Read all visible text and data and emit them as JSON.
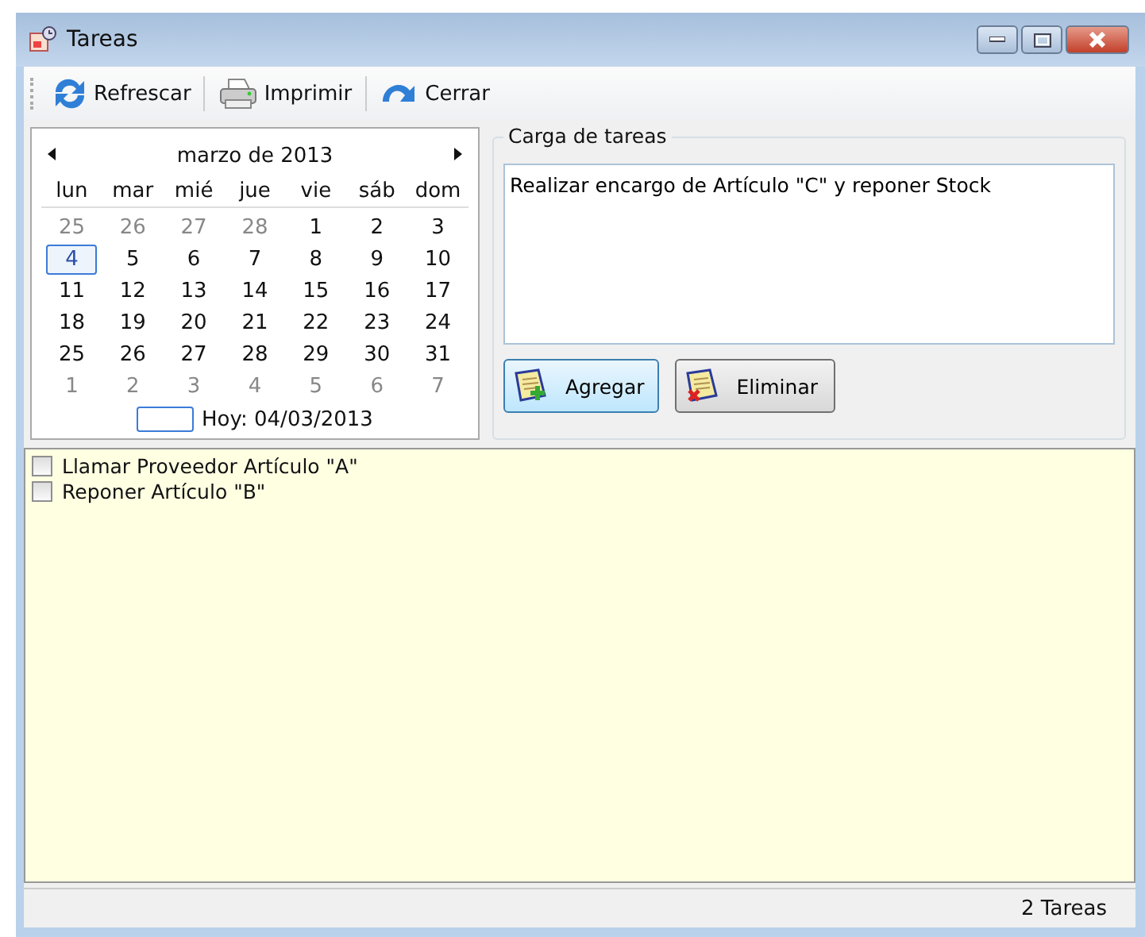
{
  "window": {
    "title": "Tareas"
  },
  "toolbar": [
    {
      "kind": "refresh",
      "label": "Refrescar"
    },
    {
      "kind": "print",
      "label": "Imprimir"
    },
    {
      "kind": "close",
      "label": "Cerrar"
    }
  ],
  "calendar": {
    "month": "marzo de 2013",
    "weekdays": [
      "lun",
      "mar",
      "mié",
      "jue",
      "vie",
      "sáb",
      "dom"
    ],
    "days": [
      {
        "label": "25",
        "other_month": true,
        "selected": false
      },
      {
        "label": "26",
        "other_month": true,
        "selected": false
      },
      {
        "label": "27",
        "other_month": true,
        "selected": false
      },
      {
        "label": "28",
        "other_month": true,
        "selected": false
      },
      {
        "label": "1",
        "other_month": false,
        "selected": false
      },
      {
        "label": "2",
        "other_month": false,
        "selected": false
      },
      {
        "label": "3",
        "other_month": false,
        "selected": false
      },
      {
        "label": "4",
        "other_month": false,
        "selected": true
      },
      {
        "label": "5",
        "other_month": false,
        "selected": false
      },
      {
        "label": "6",
        "other_month": false,
        "selected": false
      },
      {
        "label": "7",
        "other_month": false,
        "selected": false
      },
      {
        "label": "8",
        "other_month": false,
        "selected": false
      },
      {
        "label": "9",
        "other_month": false,
        "selected": false
      },
      {
        "label": "10",
        "other_month": false,
        "selected": false
      },
      {
        "label": "11",
        "other_month": false,
        "selected": false
      },
      {
        "label": "12",
        "other_month": false,
        "selected": false
      },
      {
        "label": "13",
        "other_month": false,
        "selected": false
      },
      {
        "label": "14",
        "other_month": false,
        "selected": false
      },
      {
        "label": "15",
        "other_month": false,
        "selected": false
      },
      {
        "label": "16",
        "other_month": false,
        "selected": false
      },
      {
        "label": "17",
        "other_month": false,
        "selected": false
      },
      {
        "label": "18",
        "other_month": false,
        "selected": false
      },
      {
        "label": "19",
        "other_month": false,
        "selected": false
      },
      {
        "label": "20",
        "other_month": false,
        "selected": false
      },
      {
        "label": "21",
        "other_month": false,
        "selected": false
      },
      {
        "label": "22",
        "other_month": false,
        "selected": false
      },
      {
        "label": "23",
        "other_month": false,
        "selected": false
      },
      {
        "label": "24",
        "other_month": false,
        "selected": false
      },
      {
        "label": "25",
        "other_month": false,
        "selected": false
      },
      {
        "label": "26",
        "other_month": false,
        "selected": false
      },
      {
        "label": "27",
        "other_month": false,
        "selected": false
      },
      {
        "label": "28",
        "other_month": false,
        "selected": false
      },
      {
        "label": "29",
        "other_month": false,
        "selected": false
      },
      {
        "label": "30",
        "other_month": false,
        "selected": false
      },
      {
        "label": "31",
        "other_month": false,
        "selected": false
      },
      {
        "label": "1",
        "other_month": true,
        "selected": false
      },
      {
        "label": "2",
        "other_month": true,
        "selected": false
      },
      {
        "label": "3",
        "other_month": true,
        "selected": false
      },
      {
        "label": "4",
        "other_month": true,
        "selected": false
      },
      {
        "label": "5",
        "other_month": true,
        "selected": false
      },
      {
        "label": "6",
        "other_month": true,
        "selected": false
      },
      {
        "label": "7",
        "other_month": true,
        "selected": false
      }
    ],
    "today": "Hoy: 04/03/2013"
  },
  "task_entry": {
    "legend": "Carga de tareas",
    "value": "Realizar encargo de Artículo \"C\" y reponer Stock",
    "buttons": [
      {
        "kind": "add",
        "label": "Agregar"
      },
      {
        "kind": "delete",
        "label": "Eliminar"
      }
    ]
  },
  "tasks": [
    {
      "label": "Llamar Proveedor Artículo \"A\"",
      "checked": false
    },
    {
      "label": "Reponer Artículo \"B\"",
      "checked": false
    }
  ],
  "status_bar": "2 Tareas"
}
